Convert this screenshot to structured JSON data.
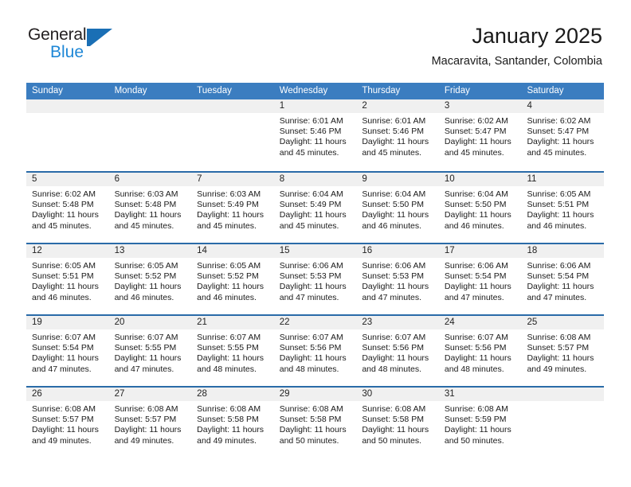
{
  "brand": {
    "name_part1": "General",
    "name_part2": "Blue",
    "logo_icon": "triangle-flag-icon"
  },
  "header": {
    "title": "January 2025",
    "subtitle": "Macaravita, Santander, Colombia"
  },
  "colors": {
    "header_blue": "#3b7dc0",
    "row_divider_blue": "#2a6ba8",
    "daynum_band": "#f0f0f0",
    "brand_blue": "#1e87d6",
    "logo_blue": "#1a6fb5"
  },
  "weekdays": [
    "Sunday",
    "Monday",
    "Tuesday",
    "Wednesday",
    "Thursday",
    "Friday",
    "Saturday"
  ],
  "weeks": [
    [
      {
        "day": "",
        "sunrise": "",
        "sunset": "",
        "daylight1": "",
        "daylight2": ""
      },
      {
        "day": "",
        "sunrise": "",
        "sunset": "",
        "daylight1": "",
        "daylight2": ""
      },
      {
        "day": "",
        "sunrise": "",
        "sunset": "",
        "daylight1": "",
        "daylight2": ""
      },
      {
        "day": "1",
        "sunrise": "Sunrise: 6:01 AM",
        "sunset": "Sunset: 5:46 PM",
        "daylight1": "Daylight: 11 hours",
        "daylight2": "and 45 minutes."
      },
      {
        "day": "2",
        "sunrise": "Sunrise: 6:01 AM",
        "sunset": "Sunset: 5:46 PM",
        "daylight1": "Daylight: 11 hours",
        "daylight2": "and 45 minutes."
      },
      {
        "day": "3",
        "sunrise": "Sunrise: 6:02 AM",
        "sunset": "Sunset: 5:47 PM",
        "daylight1": "Daylight: 11 hours",
        "daylight2": "and 45 minutes."
      },
      {
        "day": "4",
        "sunrise": "Sunrise: 6:02 AM",
        "sunset": "Sunset: 5:47 PM",
        "daylight1": "Daylight: 11 hours",
        "daylight2": "and 45 minutes."
      }
    ],
    [
      {
        "day": "5",
        "sunrise": "Sunrise: 6:02 AM",
        "sunset": "Sunset: 5:48 PM",
        "daylight1": "Daylight: 11 hours",
        "daylight2": "and 45 minutes."
      },
      {
        "day": "6",
        "sunrise": "Sunrise: 6:03 AM",
        "sunset": "Sunset: 5:48 PM",
        "daylight1": "Daylight: 11 hours",
        "daylight2": "and 45 minutes."
      },
      {
        "day": "7",
        "sunrise": "Sunrise: 6:03 AM",
        "sunset": "Sunset: 5:49 PM",
        "daylight1": "Daylight: 11 hours",
        "daylight2": "and 45 minutes."
      },
      {
        "day": "8",
        "sunrise": "Sunrise: 6:04 AM",
        "sunset": "Sunset: 5:49 PM",
        "daylight1": "Daylight: 11 hours",
        "daylight2": "and 45 minutes."
      },
      {
        "day": "9",
        "sunrise": "Sunrise: 6:04 AM",
        "sunset": "Sunset: 5:50 PM",
        "daylight1": "Daylight: 11 hours",
        "daylight2": "and 46 minutes."
      },
      {
        "day": "10",
        "sunrise": "Sunrise: 6:04 AM",
        "sunset": "Sunset: 5:50 PM",
        "daylight1": "Daylight: 11 hours",
        "daylight2": "and 46 minutes."
      },
      {
        "day": "11",
        "sunrise": "Sunrise: 6:05 AM",
        "sunset": "Sunset: 5:51 PM",
        "daylight1": "Daylight: 11 hours",
        "daylight2": "and 46 minutes."
      }
    ],
    [
      {
        "day": "12",
        "sunrise": "Sunrise: 6:05 AM",
        "sunset": "Sunset: 5:51 PM",
        "daylight1": "Daylight: 11 hours",
        "daylight2": "and 46 minutes."
      },
      {
        "day": "13",
        "sunrise": "Sunrise: 6:05 AM",
        "sunset": "Sunset: 5:52 PM",
        "daylight1": "Daylight: 11 hours",
        "daylight2": "and 46 minutes."
      },
      {
        "day": "14",
        "sunrise": "Sunrise: 6:05 AM",
        "sunset": "Sunset: 5:52 PM",
        "daylight1": "Daylight: 11 hours",
        "daylight2": "and 46 minutes."
      },
      {
        "day": "15",
        "sunrise": "Sunrise: 6:06 AM",
        "sunset": "Sunset: 5:53 PM",
        "daylight1": "Daylight: 11 hours",
        "daylight2": "and 47 minutes."
      },
      {
        "day": "16",
        "sunrise": "Sunrise: 6:06 AM",
        "sunset": "Sunset: 5:53 PM",
        "daylight1": "Daylight: 11 hours",
        "daylight2": "and 47 minutes."
      },
      {
        "day": "17",
        "sunrise": "Sunrise: 6:06 AM",
        "sunset": "Sunset: 5:54 PM",
        "daylight1": "Daylight: 11 hours",
        "daylight2": "and 47 minutes."
      },
      {
        "day": "18",
        "sunrise": "Sunrise: 6:06 AM",
        "sunset": "Sunset: 5:54 PM",
        "daylight1": "Daylight: 11 hours",
        "daylight2": "and 47 minutes."
      }
    ],
    [
      {
        "day": "19",
        "sunrise": "Sunrise: 6:07 AM",
        "sunset": "Sunset: 5:54 PM",
        "daylight1": "Daylight: 11 hours",
        "daylight2": "and 47 minutes."
      },
      {
        "day": "20",
        "sunrise": "Sunrise: 6:07 AM",
        "sunset": "Sunset: 5:55 PM",
        "daylight1": "Daylight: 11 hours",
        "daylight2": "and 47 minutes."
      },
      {
        "day": "21",
        "sunrise": "Sunrise: 6:07 AM",
        "sunset": "Sunset: 5:55 PM",
        "daylight1": "Daylight: 11 hours",
        "daylight2": "and 48 minutes."
      },
      {
        "day": "22",
        "sunrise": "Sunrise: 6:07 AM",
        "sunset": "Sunset: 5:56 PM",
        "daylight1": "Daylight: 11 hours",
        "daylight2": "and 48 minutes."
      },
      {
        "day": "23",
        "sunrise": "Sunrise: 6:07 AM",
        "sunset": "Sunset: 5:56 PM",
        "daylight1": "Daylight: 11 hours",
        "daylight2": "and 48 minutes."
      },
      {
        "day": "24",
        "sunrise": "Sunrise: 6:07 AM",
        "sunset": "Sunset: 5:56 PM",
        "daylight1": "Daylight: 11 hours",
        "daylight2": "and 48 minutes."
      },
      {
        "day": "25",
        "sunrise": "Sunrise: 6:08 AM",
        "sunset": "Sunset: 5:57 PM",
        "daylight1": "Daylight: 11 hours",
        "daylight2": "and 49 minutes."
      }
    ],
    [
      {
        "day": "26",
        "sunrise": "Sunrise: 6:08 AM",
        "sunset": "Sunset: 5:57 PM",
        "daylight1": "Daylight: 11 hours",
        "daylight2": "and 49 minutes."
      },
      {
        "day": "27",
        "sunrise": "Sunrise: 6:08 AM",
        "sunset": "Sunset: 5:57 PM",
        "daylight1": "Daylight: 11 hours",
        "daylight2": "and 49 minutes."
      },
      {
        "day": "28",
        "sunrise": "Sunrise: 6:08 AM",
        "sunset": "Sunset: 5:58 PM",
        "daylight1": "Daylight: 11 hours",
        "daylight2": "and 49 minutes."
      },
      {
        "day": "29",
        "sunrise": "Sunrise: 6:08 AM",
        "sunset": "Sunset: 5:58 PM",
        "daylight1": "Daylight: 11 hours",
        "daylight2": "and 50 minutes."
      },
      {
        "day": "30",
        "sunrise": "Sunrise: 6:08 AM",
        "sunset": "Sunset: 5:58 PM",
        "daylight1": "Daylight: 11 hours",
        "daylight2": "and 50 minutes."
      },
      {
        "day": "31",
        "sunrise": "Sunrise: 6:08 AM",
        "sunset": "Sunset: 5:59 PM",
        "daylight1": "Daylight: 11 hours",
        "daylight2": "and 50 minutes."
      },
      {
        "day": "",
        "sunrise": "",
        "sunset": "",
        "daylight1": "",
        "daylight2": ""
      }
    ]
  ]
}
